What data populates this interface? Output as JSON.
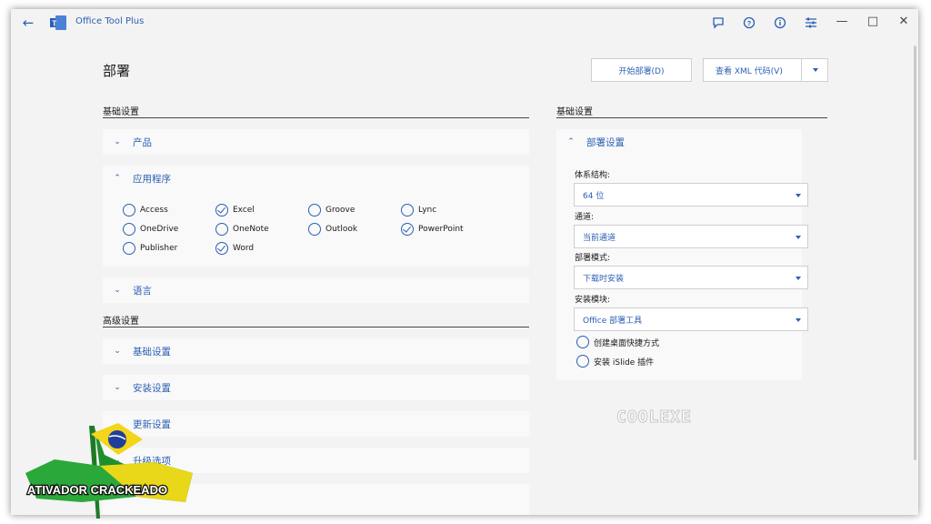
{
  "app": {
    "title": "Office Tool Plus"
  },
  "page": {
    "title": "部署"
  },
  "toolbar": {
    "deploy_label": "开始部署(D)",
    "view_xml_label": "查看 XML 代码(V)"
  },
  "basic_section": {
    "title": "基础设置"
  },
  "advanced_section": {
    "title": "高级设置"
  },
  "right_section": {
    "title": "基础设置"
  },
  "cards": {
    "products": {
      "label": "产品"
    },
    "apps": {
      "label": "应用程序"
    },
    "language": {
      "label": "语言"
    },
    "adv_basic": {
      "label": "基础设置"
    },
    "install": {
      "label": "安装设置"
    },
    "update": {
      "label": "更新设置"
    },
    "upgrade": {
      "label": "升级选项"
    }
  },
  "apps": [
    {
      "label": "Access",
      "checked": false
    },
    {
      "label": "Excel",
      "checked": true
    },
    {
      "label": "Groove",
      "checked": false
    },
    {
      "label": "Lync",
      "checked": false
    },
    {
      "label": "OneDrive",
      "checked": false
    },
    {
      "label": "OneNote",
      "checked": false
    },
    {
      "label": "Outlook",
      "checked": false
    },
    {
      "label": "PowerPoint",
      "checked": true
    },
    {
      "label": "Publisher",
      "checked": false
    },
    {
      "label": "Word",
      "checked": true
    }
  ],
  "deploy": {
    "header": "部署设置",
    "arch_label": "体系结构:",
    "arch_value": "64 位",
    "channel_label": "通道:",
    "channel_value": "当前通道",
    "mode_label": "部署模式:",
    "mode_value": "下载时安装",
    "module_label": "安装模块:",
    "module_value": "Office 部署工具",
    "desktop_shortcut_label": "创建桌面快捷方式",
    "islide_label": "安装 iSlide 插件"
  },
  "watermark": {
    "text": "COOLEXE"
  },
  "overlay_logo": {
    "text": "ATIVADOR CRACKEADO"
  },
  "colors": {
    "accent": "#2b5fb3",
    "background": "#f3f3f3",
    "card": "#f9f9f9"
  },
  "icons": [
    "back-arrow-icon",
    "office-tool-plus-logo",
    "feedback-icon",
    "help-icon",
    "info-icon",
    "settings-sliders-icon"
  ]
}
